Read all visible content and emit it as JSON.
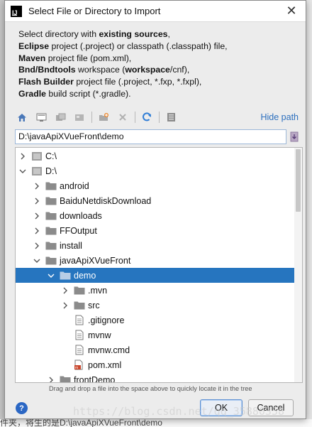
{
  "window": {
    "title": "Select File or Directory to Import",
    "app_icon_letter": "IJ",
    "close_glyph": "✕"
  },
  "description": {
    "line1": {
      "pre": "Select directory with ",
      "bold": "existing sources",
      "post": ","
    },
    "line2": {
      "bold": "Eclipse",
      "post": " project (.project) or classpath (.classpath) file,"
    },
    "line3": {
      "bold": "Maven",
      "post": " project file (pom.xml),"
    },
    "line4": {
      "bold": "Bnd/Bndtools",
      "mid": " workspace (",
      "bold2": "workspace",
      "post": "/cnf),"
    },
    "line5": {
      "bold": "Flash Builder",
      "post": " project file (.project, *.fxp, *.fxpl),"
    },
    "line6": {
      "bold": "Gradle",
      "post": " build script (*.gradle)."
    }
  },
  "toolbar": {
    "icons": [
      "home-icon",
      "desktop-icon",
      "project-icon",
      "module-icon",
      "new-folder-icon",
      "delete-icon",
      "refresh-icon",
      "show-hidden-icon"
    ],
    "hide_path_label": "Hide path"
  },
  "path": {
    "value": "D:\\javaApiXVueFront\\demo"
  },
  "tree": {
    "rows": [
      {
        "label": "C:\\",
        "level": 0,
        "expanded": false,
        "type": "drive"
      },
      {
        "label": "D:\\",
        "level": 0,
        "expanded": true,
        "type": "drive"
      },
      {
        "label": "android",
        "level": 1,
        "expanded": false,
        "type": "folder"
      },
      {
        "label": "BaiduNetdiskDownload",
        "level": 1,
        "expanded": false,
        "type": "folder"
      },
      {
        "label": "downloads",
        "level": 1,
        "expanded": false,
        "type": "folder"
      },
      {
        "label": "FFOutput",
        "level": 1,
        "expanded": false,
        "type": "folder"
      },
      {
        "label": "install",
        "level": 1,
        "expanded": false,
        "type": "folder"
      },
      {
        "label": "javaApiXVueFront",
        "level": 1,
        "expanded": true,
        "type": "folder"
      },
      {
        "label": "demo",
        "level": 2,
        "expanded": true,
        "type": "folder",
        "selected": true
      },
      {
        "label": ".mvn",
        "level": 3,
        "expanded": false,
        "type": "folder"
      },
      {
        "label": "src",
        "level": 3,
        "expanded": false,
        "type": "folder"
      },
      {
        "label": ".gitignore",
        "level": 3,
        "type": "file"
      },
      {
        "label": "mvnw",
        "level": 3,
        "type": "file"
      },
      {
        "label": "mvnw.cmd",
        "level": 3,
        "type": "file"
      },
      {
        "label": "pom.xml",
        "level": 3,
        "type": "maven"
      },
      {
        "label": "frontDemo",
        "level": 2,
        "expanded": false,
        "type": "folder"
      }
    ]
  },
  "hint": "Drag and drop a file into the space above to quickly locate it in the tree",
  "buttons": {
    "help": "?",
    "ok": "OK",
    "cancel": "Cancel"
  },
  "background": {
    "bottom_text": "件夹，将生的是D:\\javaApiXVueFront\\demo",
    "watermark": "https://blog.csdn.net/qq_35880358"
  },
  "colors": {
    "selection": "#2675bf",
    "link": "#2c6fbe",
    "folder": "#8b8b8b"
  }
}
